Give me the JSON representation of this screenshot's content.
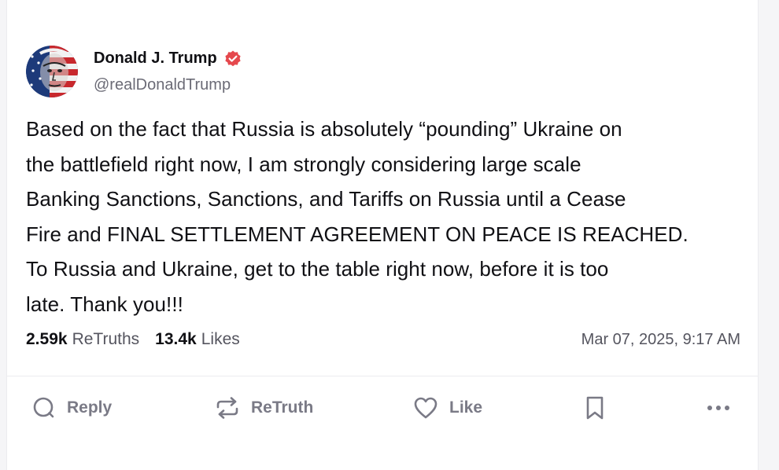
{
  "post": {
    "author": {
      "display_name": "Donald J. Trump",
      "handle": "@realDonaldTrump",
      "verified": true,
      "verified_color": "#e5484d"
    },
    "text": "Based on the fact that Russia is absolutely “pounding” Ukraine on\nthe battlefield right now, I am strongly considering large scale\nBanking Sanctions, Sanctions, and Tariffs on Russia until a Cease\nFire and FINAL SETTLEMENT AGREEMENT ON PEACE IS REACHED.\nTo Russia and Ukraine, get to the table right now, before it is too\nlate. Thank you!!!",
    "stats": {
      "retruths_count": "2.59k",
      "retruths_label": "ReTruths",
      "likes_count": "13.4k",
      "likes_label": "Likes"
    },
    "timestamp": "Mar 07, 2025, 9:17 AM"
  },
  "actions": {
    "reply_label": "Reply",
    "retruth_label": "ReTruth",
    "like_label": "Like",
    "bookmark_icon": "bookmark-icon",
    "more_icon": "more-icon"
  },
  "colors": {
    "text_primary": "#101014",
    "text_muted": "#6b6b76",
    "action_gray": "#7a7a86",
    "divider": "#ececef"
  }
}
